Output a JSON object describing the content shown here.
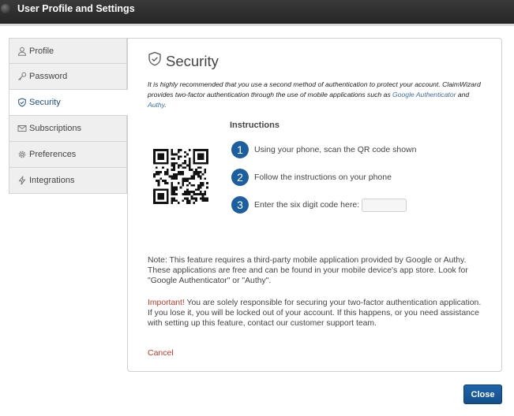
{
  "window": {
    "title": "User Profile and Settings"
  },
  "sidebar": {
    "items": [
      {
        "label": "Profile",
        "icon": "user-icon"
      },
      {
        "label": "Password",
        "icon": "key-icon"
      },
      {
        "label": "Security",
        "icon": "shield-icon",
        "active": true
      },
      {
        "label": "Subscriptions",
        "icon": "envelope-icon"
      },
      {
        "label": "Preferences",
        "icon": "gear-icon"
      },
      {
        "label": "Integrations",
        "icon": "bolt-icon"
      }
    ]
  },
  "security": {
    "heading": "Security",
    "intro_1": "It is highly recommended that you use a second method of authentication to protect your account. ClaimWizard provides two-factor authentication through the use of mobile applications such as ",
    "link_google": "Google Authenticator",
    "intro_and": " and ",
    "link_authy": "Authy",
    "intro_end": ".",
    "instructions_title": "Instructions",
    "steps": [
      {
        "num": "1",
        "text": "Using your phone, scan the QR code shown"
      },
      {
        "num": "2",
        "text": "Follow the instructions on your phone"
      },
      {
        "num": "3",
        "text": "Enter the six digit code here:"
      }
    ],
    "code_value": "",
    "note": "Note: This feature requires a third-party mobile application provided by Google or Authy. These applications are free and can be found in your mobile device's app store. Look for \"Google Authenticator\" or \"Authy\".",
    "important_label": "Important!",
    "important_text": " You are solely responsible for securing your two-factor authentication application. If you lose it, you will be locked out of your account. If this happens, or you need assistance with setting up this feature, contact our customer support team.",
    "cancel_label": "Cancel"
  },
  "footer": {
    "close_label": "Close"
  },
  "colors": {
    "accent": "#1b5fa0",
    "warning": "#c0392b",
    "link": "#3b6ea5"
  }
}
